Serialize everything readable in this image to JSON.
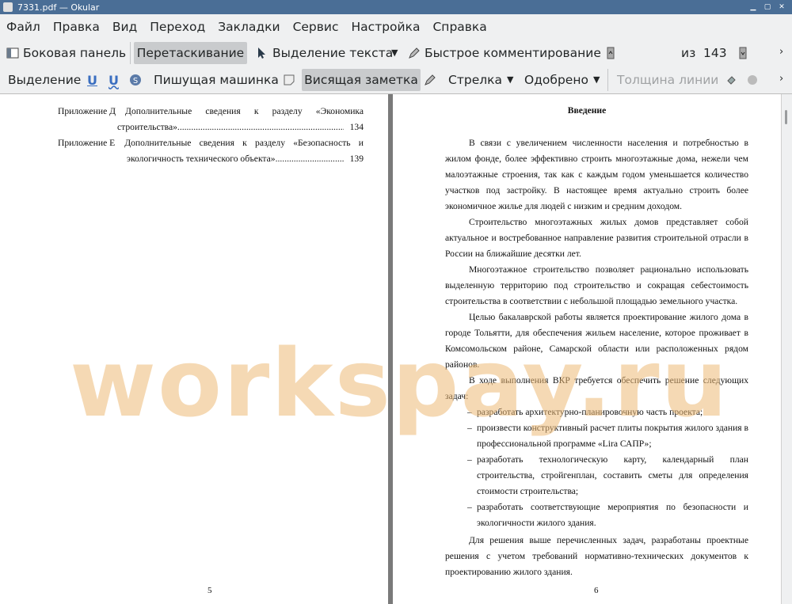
{
  "window": {
    "title": "7331.pdf — Okular"
  },
  "menubar": {
    "items": [
      "Файл",
      "Правка",
      "Вид",
      "Переход",
      "Закладки",
      "Сервис",
      "Настройка",
      "Справка"
    ]
  },
  "toolbar1": {
    "sidebar": "Боковая панель",
    "drag": "Перетаскивание",
    "text_select": "Выделение текста",
    "quick_annot": "Быстрое комментирование",
    "page_current": "5",
    "page_of": "из",
    "page_total": "143"
  },
  "toolbar2": {
    "select": "Выделение",
    "typewriter": "Пишущая машинка",
    "popup_note": "Висящая заметка",
    "arrow": "Стрелка",
    "approved": "Одобрено",
    "line_width": "Толщина линии"
  },
  "page5": {
    "toc": [
      {
        "prefix": "Приложение Д",
        "title1": "Дополнительные сведения к разделу «Экономика",
        "title2": "строительства»",
        "page": "134"
      },
      {
        "prefix": "Приложение Е",
        "title1": "Дополнительные сведения к разделу «Безопасность и",
        "title2": "экологичность технического объекта»",
        "page": "139"
      }
    ],
    "number": "5"
  },
  "page6": {
    "heading": "Введение",
    "paragraphs": [
      "В связи с увеличением численности населения и потребностью в жилом фонде, более эффективно строить многоэтажные дома, нежели чем малоэтажные строения, так как с каждым годом уменьшается количество участков под застройку. В настоящее время актуально строить более экономичное жилье для людей с низким и средним доходом.",
      "Строительство многоэтажных жилых домов представляет собой актуальное и востребованное направление развития строительной отрасли в России на ближайшие десятки лет.",
      "Многоэтажное строительство позволяет рационально использовать выделенную территорию под строительство и сокращая себестоимость строительства в соответствии с небольшой площадью земельного участка.",
      "Целью бакалаврской работы является проектирование жилого дома в городе Тольятти, для обеспечения жильем население, которое проживает в Комсомольском районе, Самарской области или расположенных рядом районов.",
      "В ходе выполнения ВКР требуется обеспечить решение следующих задач:"
    ],
    "list": [
      "разработать архитектурно-планировочную часть проекта;",
      "произвести конструктивный расчет плиты покрытия жилого здания в профессиональной программе «Lira САПР»;",
      "разработать технологическую карту, календарный план строительства, стройгенплан, составить сметы для определения стоимости строительства;",
      "разработать соответствующие мероприятия по безопасности и экологичности жилого здания."
    ],
    "final": "Для решения выше перечисленных задач, разработаны проектные решения с учетом требований нормативно-технических документов к проектированию жилого здания.",
    "number": "6"
  },
  "watermark": "workspay.ru"
}
